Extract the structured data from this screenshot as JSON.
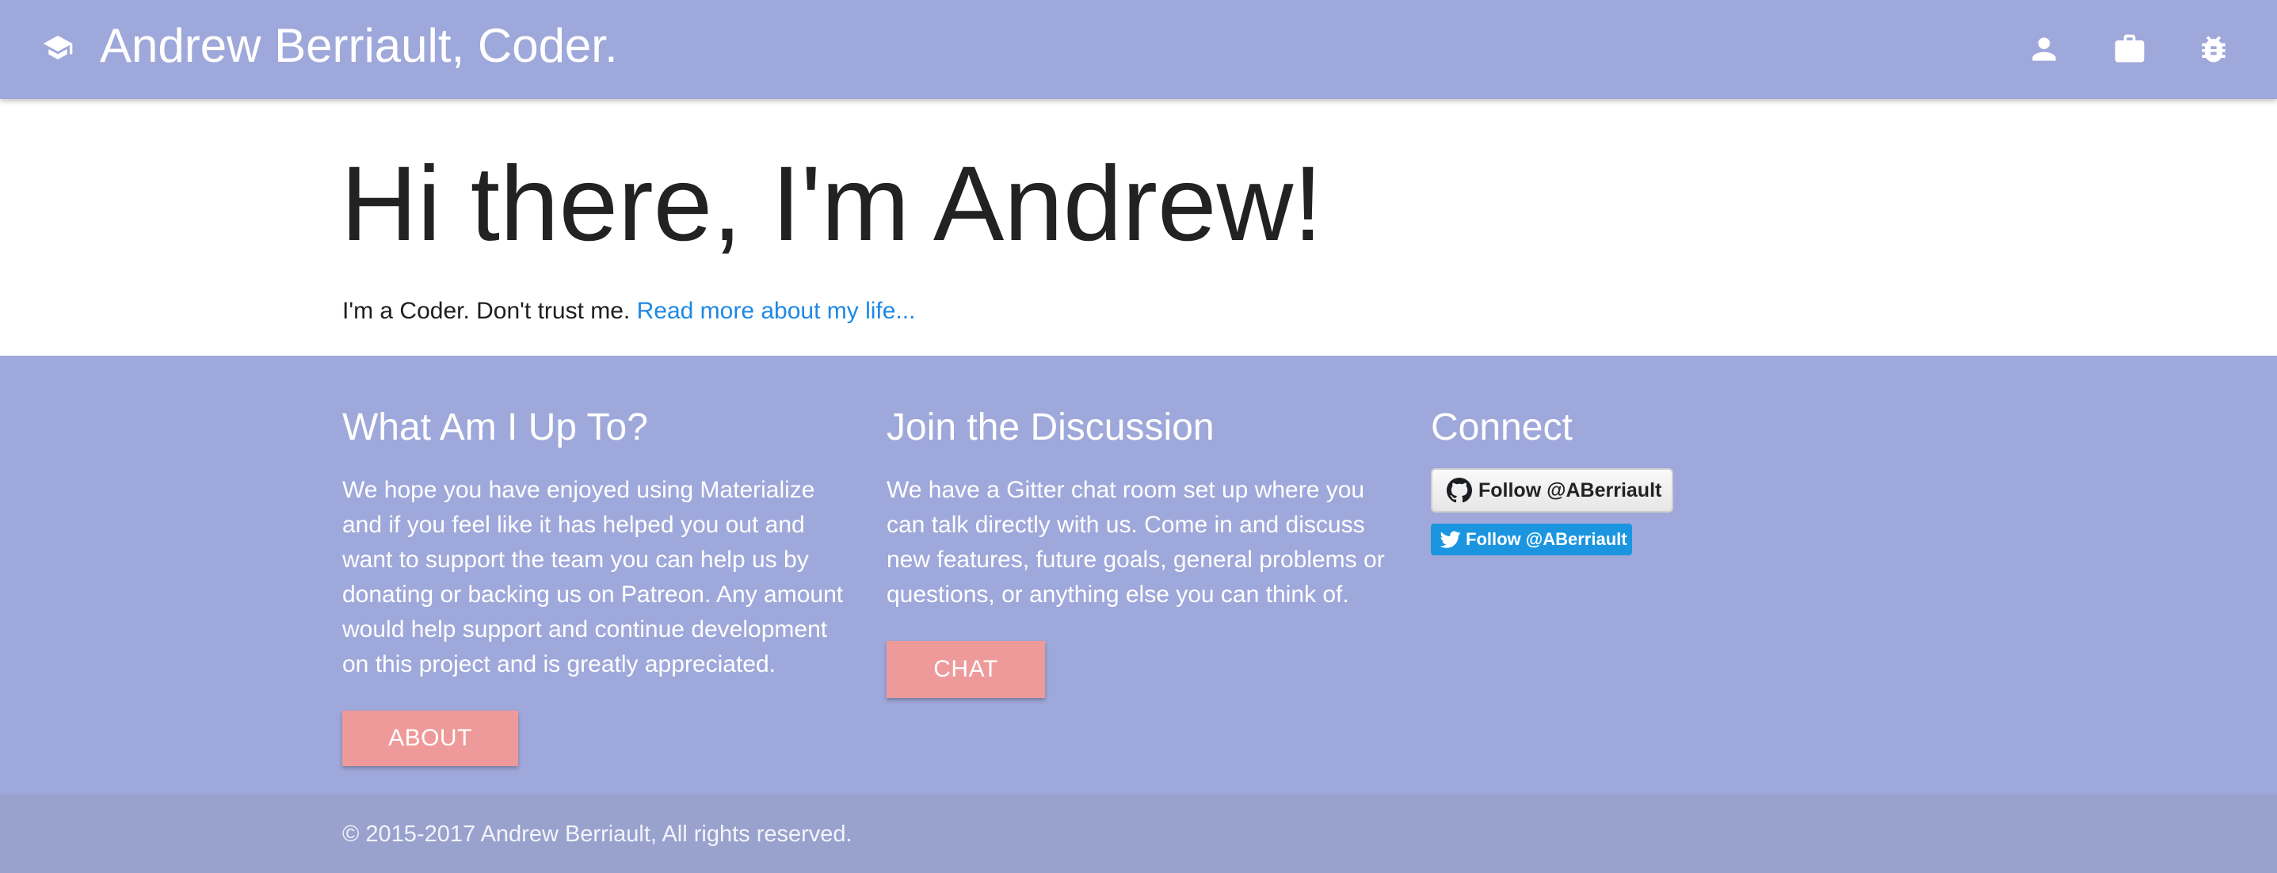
{
  "navbar": {
    "brand_icon": "graduation-cap-icon",
    "title": "Andrew Berriault, Coder.",
    "icons": [
      "person-icon",
      "briefcase-icon",
      "bug-icon"
    ]
  },
  "hero": {
    "title": "Hi there, I'm Andrew!",
    "text": "I'm a Coder. Don't trust me. ",
    "link": "Read more about my life..."
  },
  "footer": {
    "col1": {
      "heading": "What Am I Up To?",
      "body": "We hope you have enjoyed using Materialize and if you feel like it has helped you out and want to support the team you can help us by donating or backing us on Patreon. Any amount would help support and continue development on this project and is greatly appreciated.",
      "button": "ABOUT"
    },
    "col2": {
      "heading": "Join the Discussion",
      "body": "We have a Gitter chat room set up where you can talk directly with us. Come in and discuss new features, future goals, general problems or questions, or anything else you can think of.",
      "button": "CHAT"
    },
    "col3": {
      "heading": "Connect",
      "github_button": "Follow @ABerriault",
      "twitter_button": "Follow @ABerriault"
    }
  },
  "copyright": "© 2015-2017 Andrew Berriault, All rights reserved.",
  "colors": {
    "primary": "#9fa8da",
    "accent": "#ef9a9a",
    "link": "#1e88e5",
    "twitter": "#1b95e0"
  }
}
